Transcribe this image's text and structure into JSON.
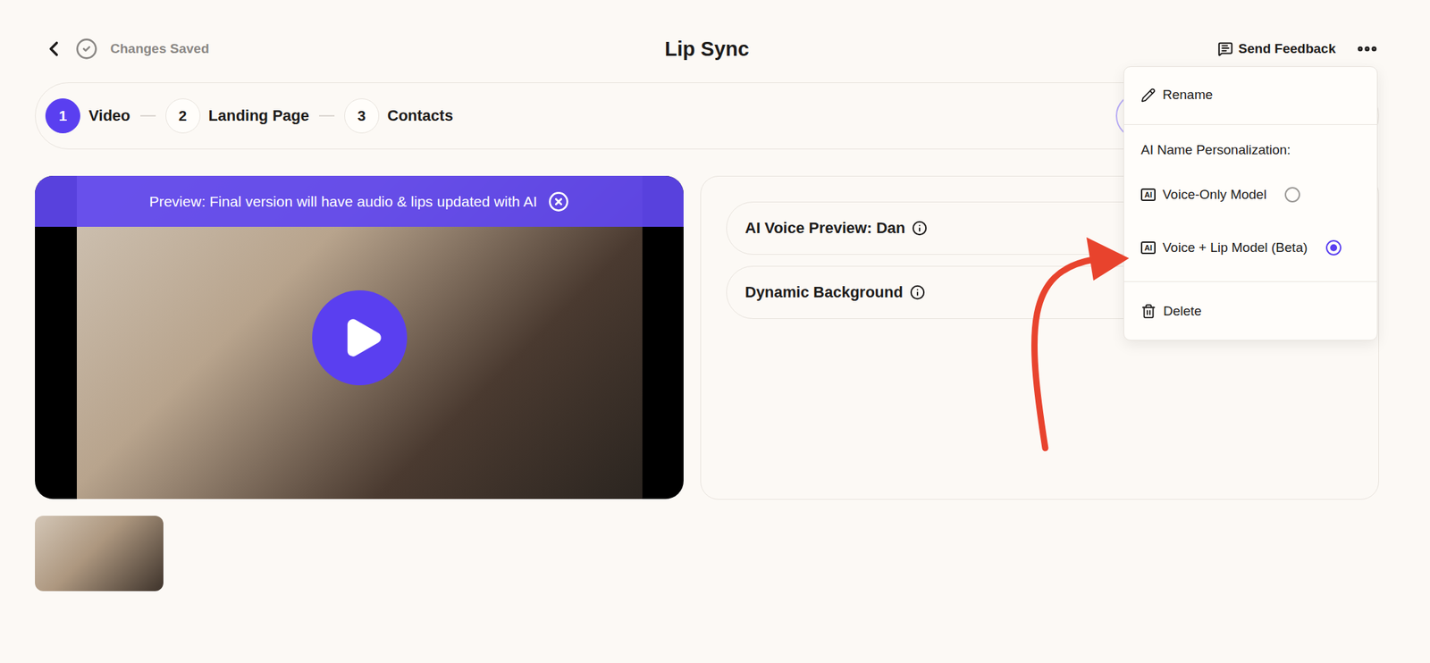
{
  "header": {
    "status": "Changes Saved",
    "title": "Lip Sync",
    "feedback": "Send Feedback"
  },
  "steps": [
    {
      "number": "1",
      "label": "Video",
      "selected": true
    },
    {
      "number": "2",
      "label": "Landing Page",
      "selected": false
    },
    {
      "number": "3",
      "label": "Contacts",
      "selected": false
    }
  ],
  "preview": {
    "banner": "Preview: Final version will have audio & lips updated with AI",
    "playing": false
  },
  "settings": [
    {
      "label": "AI Voice Preview: Dan"
    },
    {
      "label": "Dynamic Background"
    }
  ],
  "menu": {
    "items": [
      {
        "kind": "rename",
        "label": "Rename"
      },
      {
        "kind": "separator"
      },
      {
        "kind": "heading",
        "label": "AI Name Personalization:"
      },
      {
        "kind": "radio",
        "badge": "AI",
        "label": "Voice-Only Model",
        "selected": false
      },
      {
        "kind": "radio",
        "badge": "AI",
        "label": "Voice + Lip Model (Beta)",
        "selected": true
      },
      {
        "kind": "separator"
      },
      {
        "kind": "delete",
        "label": "Delete"
      }
    ]
  }
}
